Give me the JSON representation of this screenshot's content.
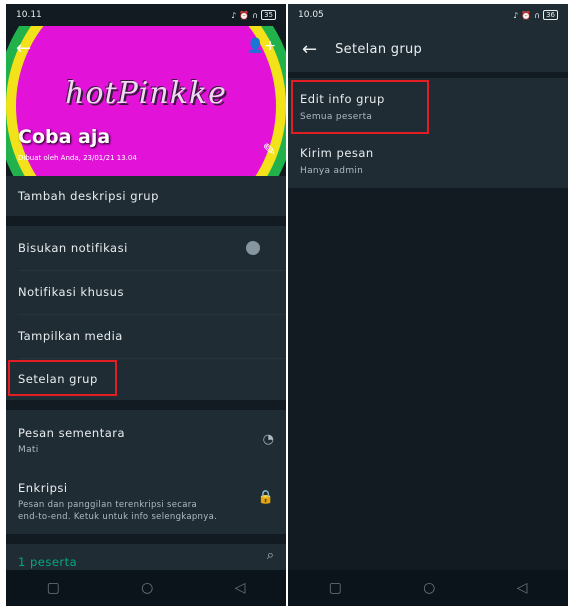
{
  "left": {
    "status": {
      "time": "10.11",
      "battery": "35"
    },
    "header": {
      "logo_text": "hotPinkke",
      "group_name": "Coba aja",
      "created": "Dibuat oleh Anda, 23/01/21 13.04"
    },
    "rows": {
      "add_description": "Tambah deskripsi grup",
      "mute": "Bisukan notifikasi",
      "custom_notif": "Notifikasi khusus",
      "media": "Tampilkan media",
      "group_settings": "Setelan grup",
      "disappearing": "Pesan sementara",
      "disappearing_value": "Mati",
      "encryption": "Enkripsi",
      "encryption_desc_1": "Pesan dan panggilan terenkripsi secara",
      "encryption_desc_2": "end-to-end. Ketuk untuk info selengkapnya.",
      "participants": "1 peserta"
    }
  },
  "right": {
    "status": {
      "time": "10.05",
      "battery": "36"
    },
    "title": "Setelan grup",
    "items": [
      {
        "label": "Edit info grup",
        "value": "Semua peserta"
      },
      {
        "label": "Kirim pesan",
        "value": "Hanya admin"
      }
    ]
  },
  "icons": {
    "back": "arrow-left-icon",
    "add_participant": "person-add-icon",
    "edit": "pencil-icon",
    "timer": "timer-icon",
    "lock": "lock-icon",
    "search": "search-icon"
  },
  "colors": {
    "background": "#111b21",
    "card": "#1f2c34",
    "accent": "#00a884",
    "highlight": "#e21d23"
  }
}
